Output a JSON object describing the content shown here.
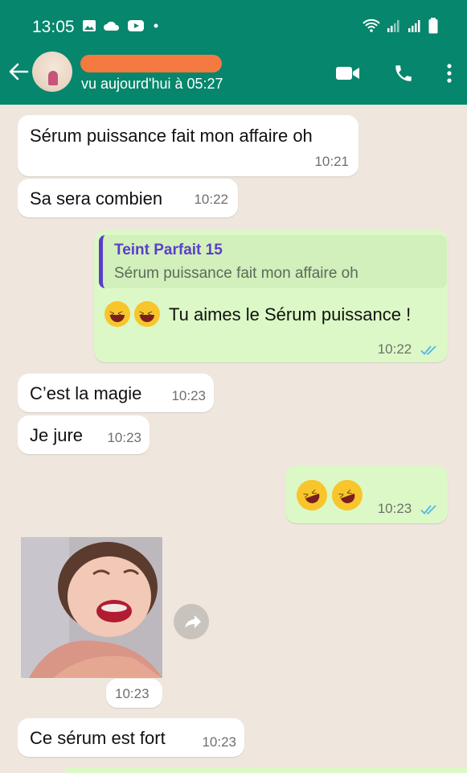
{
  "status_bar": {
    "time": "13:05"
  },
  "header": {
    "subtitle": "vu aujourd'hui à 05:27"
  },
  "messages": [
    {
      "text": "Sérum puissance fait mon affaire oh",
      "time": "10:21"
    },
    {
      "text": "Sa sera combien",
      "time": "10:22"
    },
    {
      "quote_name": "Teint Parfait 15",
      "quote_text": "Sérum puissance fait mon affaire oh",
      "text": "Tu aimes le Sérum puissance !",
      "time": "10:22"
    },
    {
      "text": "C’est la magie",
      "time": "10:23"
    },
    {
      "text": "Je jure",
      "time": "10:23"
    },
    {
      "time": "10:23"
    },
    {
      "time": "10:23"
    },
    {
      "text": "Ce sérum est fort",
      "time": "10:23"
    }
  ],
  "colors": {
    "header": "#06866c",
    "outgoing_bubble": "#dcf8c6",
    "incoming_bubble": "#ffffff",
    "chat_bg": "#efe7de",
    "read_ticks": "#4fb6ec"
  }
}
